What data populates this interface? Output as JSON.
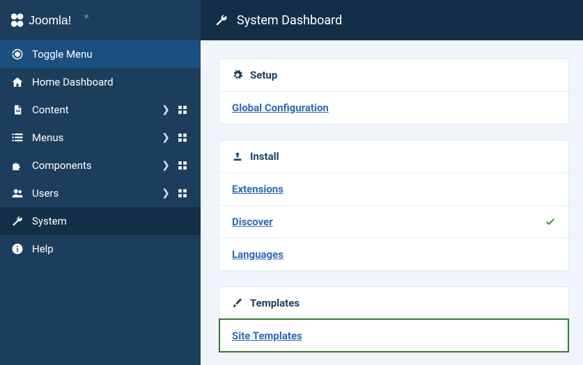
{
  "brand": {
    "name": "Joomla!"
  },
  "header": {
    "title": "System Dashboard"
  },
  "sidebar": {
    "toggle": {
      "label": "Toggle Menu"
    },
    "items": [
      {
        "label": "Home Dashboard",
        "has_submenu": false,
        "has_grid": false
      },
      {
        "label": "Content",
        "has_submenu": true,
        "has_grid": true
      },
      {
        "label": "Menus",
        "has_submenu": true,
        "has_grid": true
      },
      {
        "label": "Components",
        "has_submenu": true,
        "has_grid": true
      },
      {
        "label": "Users",
        "has_submenu": true,
        "has_grid": true
      },
      {
        "label": "System",
        "has_submenu": false,
        "has_grid": false,
        "active": true
      },
      {
        "label": "Help",
        "has_submenu": false,
        "has_grid": false
      }
    ]
  },
  "cards": [
    {
      "title": "Setup",
      "links": [
        {
          "label": "Global Configuration",
          "checked": false
        }
      ]
    },
    {
      "title": "Install",
      "links": [
        {
          "label": "Extensions",
          "checked": false
        },
        {
          "label": "Discover",
          "checked": true
        },
        {
          "label": "Languages",
          "checked": false
        }
      ]
    },
    {
      "title": "Templates",
      "links": [
        {
          "label": "Site Templates",
          "checked": false,
          "highlight": true
        }
      ]
    }
  ]
}
